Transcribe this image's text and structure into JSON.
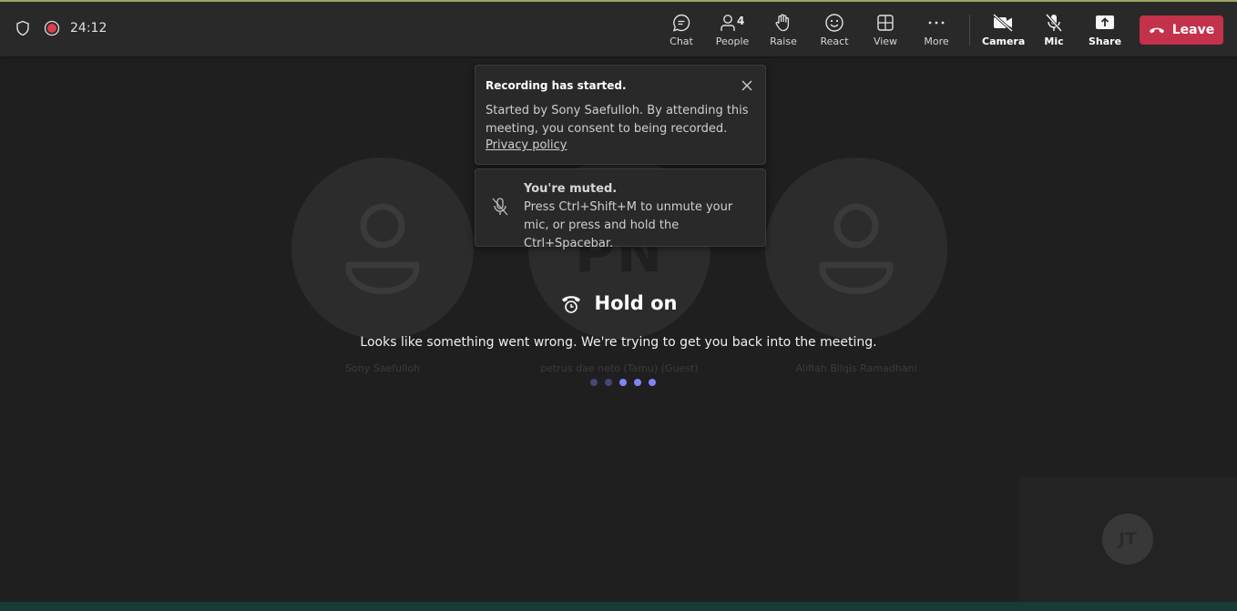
{
  "meeting": {
    "timer": "24:12"
  },
  "toolbar": {
    "chat": "Chat",
    "people": "People",
    "people_count": "4",
    "raise": "Raise",
    "react": "React",
    "view": "View",
    "more": "More",
    "camera": "Camera",
    "mic": "Mic",
    "share": "Share",
    "leave": "Leave"
  },
  "participants": [
    {
      "name": "Sony Saefulloh"
    },
    {
      "name": "petrus dae neto (Tamu) (Guest)",
      "initials": "PN"
    },
    {
      "name": "Alifiah Bilqis Ramadhani"
    }
  ],
  "recording_toast": {
    "title": "Recording has started.",
    "body": "Started by Sony Saefulloh. By attending this meeting, you consent to being recorded.",
    "link": "Privacy policy"
  },
  "muted_toast": {
    "title": "You're muted.",
    "body": "Press Ctrl+Shift+M to unmute your mic, or press and hold the Ctrl+Spacebar."
  },
  "reconnect": {
    "title": "Hold on",
    "message": "Looks like something went wrong. We're trying to get you back into the meeting."
  },
  "self_view": {
    "initials": "JT"
  },
  "colors": {
    "accent": "#7f85f5",
    "leave_red": "#c4314b",
    "record_red": "#e03c4f"
  }
}
